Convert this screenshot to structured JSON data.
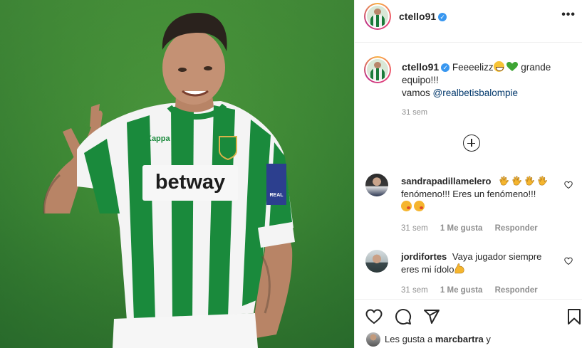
{
  "post": {
    "username": "ctello91",
    "verified_mark": "✓",
    "more_icon": "ellipsis-icon",
    "caption": {
      "text_1": "Feeeelizz",
      "text_2": "grande equipo!!!",
      "text_3": "vamos",
      "mention": "@realbetisbalompie",
      "time": "31 sem",
      "emojis": [
        "grinning-face",
        "green-heart"
      ]
    },
    "load_more_icon": "plus-circle-icon",
    "comments": [
      {
        "username": "sandrapadillamelero",
        "text": "fenómeno!!! Eres un fenómeno!!!",
        "emojis_before": [
          "clapping-hands",
          "clapping-hands",
          "clapping-hands",
          "clapping-hands"
        ],
        "emojis_after": [
          "kissing-face",
          "kissing-face"
        ],
        "time": "31 sem",
        "likes": "1 Me gusta",
        "reply": "Responder"
      },
      {
        "username": "jordifortes",
        "text": "Vaya jugador siempre eres mi ídolo",
        "emojis_after": [
          "flexed-biceps"
        ],
        "time": "31 sem",
        "likes": "1 Me gusta",
        "reply": "Responder"
      }
    ],
    "actions": [
      "heart-icon",
      "comment-icon",
      "share-icon",
      "bookmark-icon"
    ],
    "liked_by_prefix": "Les gusta a",
    "liked_by_user": "marcbartra",
    "liked_by_suffix": "y"
  },
  "photo": {
    "subject": "player-photo",
    "shirt_sponsor": "betway",
    "sleeve_patch": "REAL"
  },
  "colors": {
    "accent_link": "#00376b",
    "verified": "#3897f0",
    "muted": "#8e8e8e",
    "kit_green": "#1a8a3c"
  }
}
